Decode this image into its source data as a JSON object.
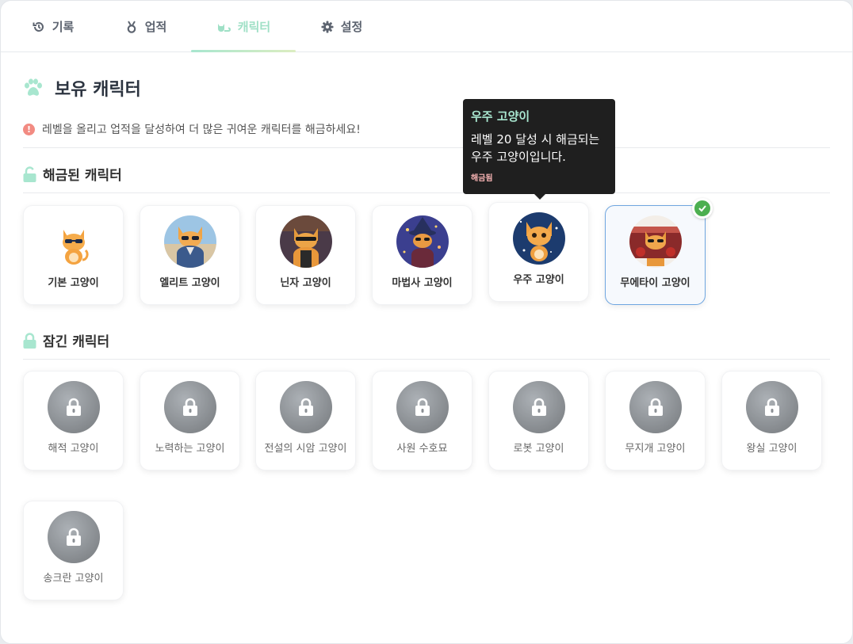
{
  "tabs": [
    {
      "label": "기록",
      "icon": "history-icon"
    },
    {
      "label": "업적",
      "icon": "medal-icon"
    },
    {
      "label": "캐릭터",
      "icon": "cat-icon",
      "active": true
    },
    {
      "label": "설정",
      "icon": "gear-icon"
    }
  ],
  "header": {
    "title": "보유 캐릭터",
    "info": "레벨을 올리고 업적을 달성하여 더 많은 귀여운 캐릭터를 해금하세요!"
  },
  "unlocked_section": {
    "title": "해금된 캐릭터"
  },
  "locked_section": {
    "title": "잠긴 캐릭터"
  },
  "unlocked": [
    {
      "name": "기본 고양이"
    },
    {
      "name": "엘리트 고양이"
    },
    {
      "name": "닌자 고양이"
    },
    {
      "name": "마법사 고양이"
    },
    {
      "name": "우주 고양이"
    },
    {
      "name": "무에타이 고양이",
      "selected": true
    }
  ],
  "locked": [
    {
      "name": "해적 고양이"
    },
    {
      "name": "노력하는 고양이"
    },
    {
      "name": "전설의 시암 고양이"
    },
    {
      "name": "사원 수호묘"
    },
    {
      "name": "로봇 고양이"
    },
    {
      "name": "무지개 고양이"
    },
    {
      "name": "왕실 고양이"
    },
    {
      "name": "송크란 고양이"
    }
  ],
  "tooltip": {
    "title": "우주 고양이",
    "desc_line1": "레벨 20 달성 시 해금되는",
    "desc_line2": "우주 고양이입니다.",
    "status": "해금됨"
  },
  "colors": {
    "accent": "#a8e6cf",
    "selected_border": "#6fa6e0",
    "check": "#4caf50"
  }
}
